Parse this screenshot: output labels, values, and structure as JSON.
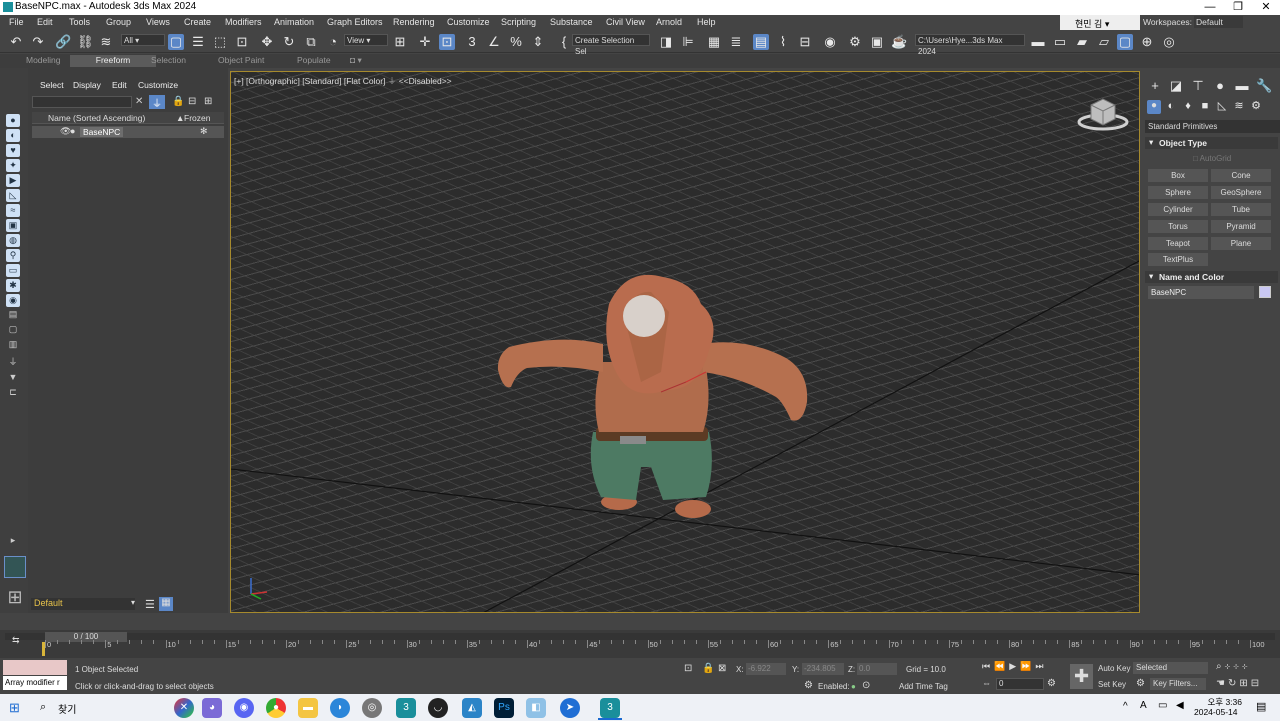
{
  "window": {
    "title": "BaseNPC.max - Autodesk 3ds Max 2024",
    "minimize": "—",
    "restore": "❐",
    "close": "✕"
  },
  "menu": [
    "File",
    "Edit",
    "Tools",
    "Group",
    "Views",
    "Create",
    "Modifiers",
    "Animation",
    "Graph Editors",
    "Rendering",
    "Customize",
    "Scripting",
    "Substance",
    "Civil View",
    "Arnold",
    "Help"
  ],
  "user": {
    "name": "현민 김"
  },
  "workspace": {
    "label": "Workspaces:",
    "value": "Default"
  },
  "toolbar": {
    "filter": "All",
    "ref_coord": "View",
    "selection_set": "Create Selection Sel",
    "path": "C:\\Users\\Hye...3ds Max 2024"
  },
  "ribbon_tabs": [
    "Modeling",
    "Freeform",
    "Selection",
    "Object Paint",
    "Populate"
  ],
  "scene_explorer": {
    "menus": [
      "Select",
      "Display",
      "Edit",
      "Customize"
    ],
    "col_name": "Name (Sorted Ascending)",
    "col_frozen": "Frozen",
    "object": "BaseNPC"
  },
  "layer": {
    "name": "Default"
  },
  "viewport": {
    "label": "[+] [Orthographic] [Standard] [Flat Color]",
    "disabled": "<<Disabled>>"
  },
  "command_panel": {
    "category": "Standard Primitives",
    "object_type": "Object Type",
    "autogrid": "AutoGrid",
    "buttons": [
      "Box",
      "Cone",
      "Sphere",
      "GeoSphere",
      "Cylinder",
      "Tube",
      "Torus",
      "Pyramid",
      "Teapot",
      "Plane",
      "TextPlus"
    ],
    "name_color": "Name and Color",
    "object_name": "BaseNPC",
    "object_color": "#c9c7f2"
  },
  "timeline": {
    "frame": "0 / 100",
    "ticks": [
      "0",
      "5",
      "10",
      "15",
      "20",
      "25",
      "30",
      "35",
      "40",
      "45",
      "50",
      "55",
      "60",
      "65",
      "70",
      "75",
      "80",
      "85",
      "90",
      "95",
      "100"
    ]
  },
  "status": {
    "maxscript": "Array modifier r",
    "selected": "1 Object Selected",
    "prompt": "Click or click-and-drag to select objects",
    "x_label": "X:",
    "x": "-6.922",
    "y_label": "Y:",
    "y": "-234.805",
    "z_label": "Z:",
    "z": "0.0",
    "grid": "Grid = 10.0",
    "enabled": "Enabled:",
    "add_time_tag": "Add Time Tag",
    "auto_key": "Auto Key",
    "set_key": "Set Key",
    "key_mode": "Selected",
    "key_filters": "Key Filters...",
    "frame": "0"
  },
  "taskbar": {
    "search": "찾기",
    "time": "오후 3:36",
    "date": "2024-05-14"
  }
}
